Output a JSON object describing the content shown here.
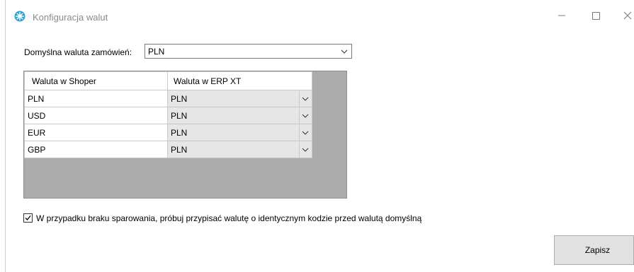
{
  "window": {
    "title": "Konfiguracja walut",
    "controls": [
      "minimize",
      "maximize",
      "close"
    ]
  },
  "default_currency": {
    "label": "Domyślna waluta zamówień:",
    "value": "PLN"
  },
  "grid": {
    "headers": [
      "Waluta w Shoper",
      "Waluta w ERP XT"
    ],
    "rows": [
      {
        "shoper": "PLN",
        "erp": "PLN"
      },
      {
        "shoper": "USD",
        "erp": "PLN"
      },
      {
        "shoper": "EUR",
        "erp": "PLN"
      },
      {
        "shoper": "GBP",
        "erp": "PLN"
      }
    ]
  },
  "fallback_option": {
    "label": "W przypadku braku sparowania, próbuj przypisać walutę o identycznym kodzie przed walutą domyślną",
    "checked": true
  },
  "buttons": {
    "save_label": "Zapisz"
  },
  "colors": {
    "grid_background": "#ababab",
    "combo_cell": "#e6e6e6",
    "button_face": "#e1e1e1",
    "app_icon": "#2a9fd8"
  }
}
